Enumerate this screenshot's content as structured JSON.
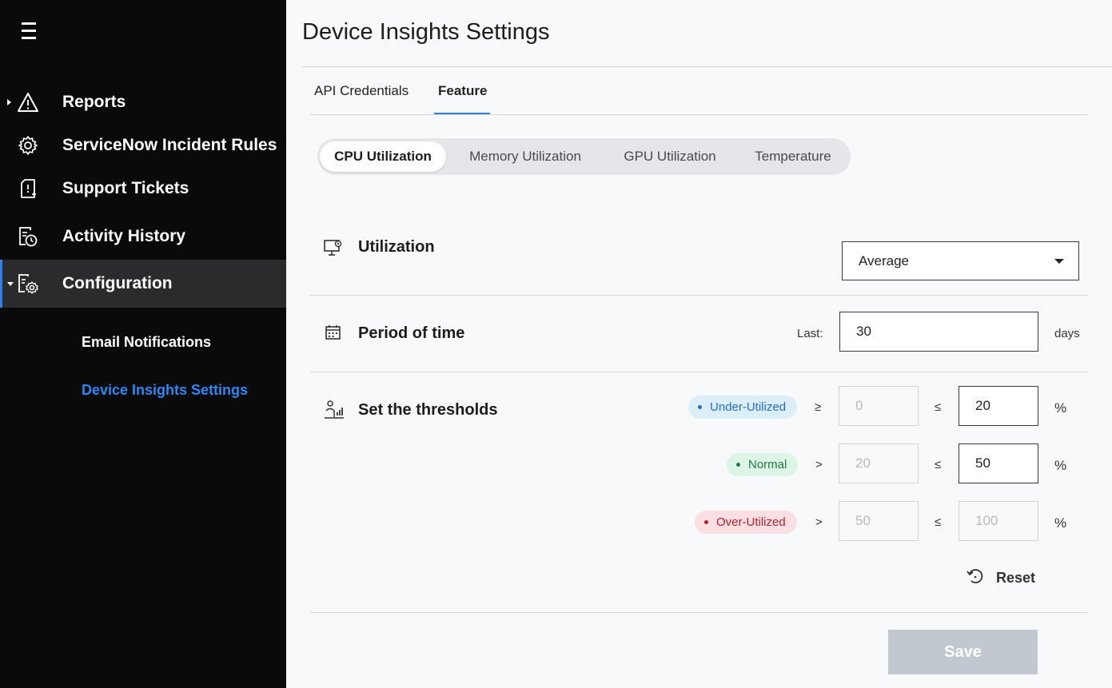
{
  "sidebar": {
    "items": [
      {
        "label": "Reports",
        "icon": "warning-icon"
      },
      {
        "label": "ServiceNow Incident Rules",
        "icon": "gear-icon"
      },
      {
        "label": "Support Tickets",
        "icon": "ticket-icon"
      },
      {
        "label": "Activity History",
        "icon": "history-icon"
      },
      {
        "label": "Configuration",
        "icon": "config-icon"
      }
    ],
    "sub_items": [
      {
        "label": "Email Notifications"
      },
      {
        "label": "Device Insights Settings"
      }
    ],
    "accent_color": "#2f80ed"
  },
  "page": {
    "title": "Device Insights Settings"
  },
  "tabs": [
    {
      "label": "API Credentials"
    },
    {
      "label": "Feature"
    }
  ],
  "segments": [
    {
      "label": "CPU Utilization"
    },
    {
      "label": "Memory Utilization"
    },
    {
      "label": "GPU Utilization"
    },
    {
      "label": "Temperature"
    }
  ],
  "utilization": {
    "label": "Utilization",
    "selected": "Average"
  },
  "period": {
    "label": "Period of time",
    "last_label": "Last:",
    "value": "30",
    "unit": "days"
  },
  "thresholds": {
    "label": "Set the thresholds",
    "rows": [
      {
        "badge": "Under-Utilized",
        "op1": "≥",
        "min": "0",
        "op2": "≤",
        "max": "20",
        "unit": "%"
      },
      {
        "badge": "Normal",
        "op1": ">",
        "min": "20",
        "op2": "≤",
        "max": "50",
        "unit": "%"
      },
      {
        "badge": "Over-Utilized",
        "op1": ">",
        "min": "50",
        "op2": "≤",
        "max": "100",
        "unit": "%"
      }
    ],
    "reset_label": "Reset"
  },
  "actions": {
    "save_label": "Save"
  }
}
